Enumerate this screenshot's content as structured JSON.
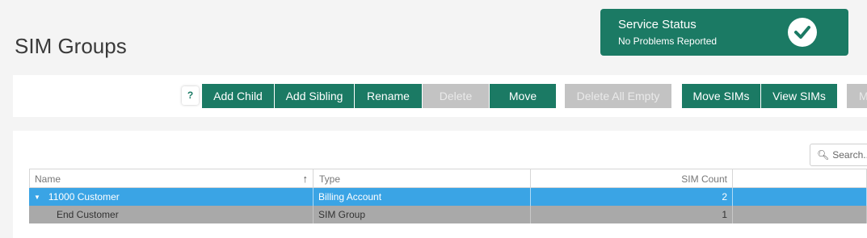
{
  "page": {
    "title": "SIM Groups"
  },
  "status": {
    "title": "Service Status",
    "subtitle": "No Problems Reported",
    "icon": "check-circle-icon"
  },
  "toolbar": {
    "help_label": "?",
    "add_child": "Add Child",
    "add_sibling": "Add Sibling",
    "rename": "Rename",
    "delete": "Delete",
    "move": "Move",
    "delete_all_empty": "Delete All Empty",
    "move_sims": "Move SIMs",
    "view_sims": "View SIMs",
    "more_truncated": "M"
  },
  "search": {
    "placeholder": "Search..."
  },
  "grid": {
    "columns": {
      "name": "Name",
      "type": "Type",
      "sim_count": "SIM Count"
    },
    "sort_indicator": "↑",
    "rows": [
      {
        "name": "11000 Customer",
        "type": "Billing Account",
        "sim_count": "2",
        "expanded": true,
        "selected": true
      },
      {
        "name": "End Customer",
        "type": "SIM Group",
        "sim_count": "1",
        "expanded": false,
        "selected": false
      }
    ]
  },
  "colors": {
    "brand": "#1b7a64",
    "selected_row": "#3aa4e5",
    "disabled": "#c3c3c3"
  }
}
